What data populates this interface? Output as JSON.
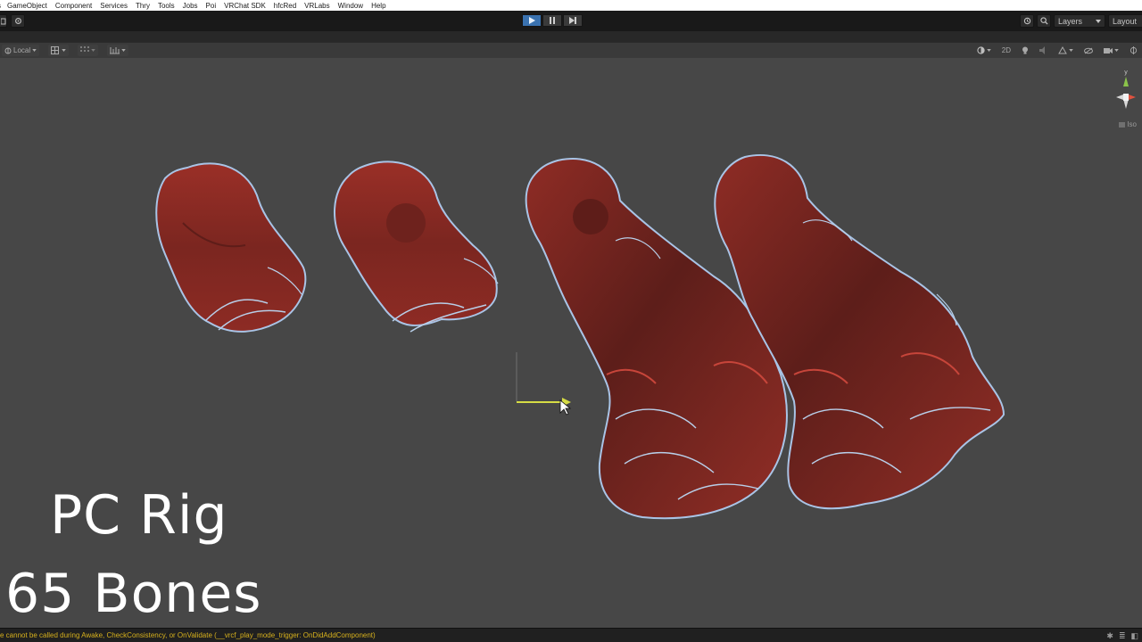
{
  "menu": [
    "s",
    "GameObject",
    "Component",
    "Services",
    "Thry",
    "Tools",
    "Jobs",
    "Poi",
    "VRChat SDK",
    "hfcRed",
    "VRLabs",
    "Window",
    "Help"
  ],
  "toolbar": {
    "left_icons": [
      "panel-icon",
      "settings-icon"
    ],
    "play_buttons": [
      "play-icon",
      "pause-icon",
      "step-icon"
    ],
    "history_icon": "history-icon",
    "search_icon": "search-icon",
    "layers_label": "Layers",
    "layout_label": "Layout"
  },
  "scene_toolbar": {
    "pivot_label": "Local",
    "right_label_2d": "2D"
  },
  "gizmo": {
    "y_label": "y",
    "iso_label": "Iso"
  },
  "overlay": {
    "title": "PC Rig",
    "subtitle": "65 Bones"
  },
  "status": {
    "message": "e cannot be called during Awake, CheckConsistency, or OnValidate (__vrcf_play_mode_trigger: OnDidAddComponent)"
  },
  "colors": {
    "hair": "#8e2b24",
    "hair_dark": "#5a1f1b",
    "outline": "#a9c4e6",
    "bg": "#474747",
    "warning": "#d7b11d",
    "play_active": "#3a72b0"
  }
}
